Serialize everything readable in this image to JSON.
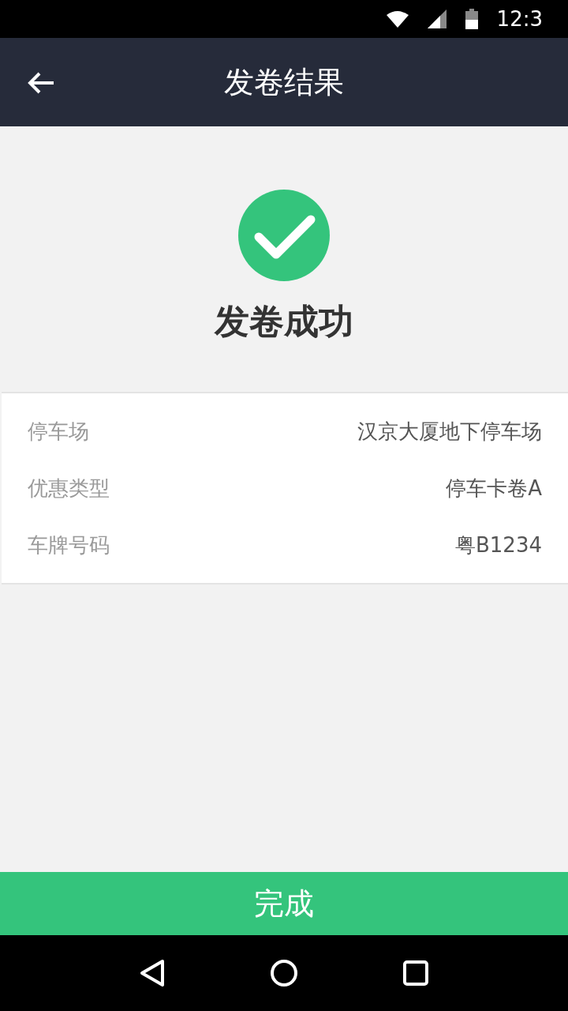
{
  "status_bar": {
    "time": "12:3"
  },
  "header": {
    "title": "发卷结果"
  },
  "result": {
    "title": "发卷成功"
  },
  "details": [
    {
      "label": "停车场",
      "value": "汉京大厦地下停车场"
    },
    {
      "label": "优惠类型",
      "value": "停车卡卷A"
    },
    {
      "label": "车牌号码",
      "value": "粤B1234"
    }
  ],
  "done_button": {
    "label": "完成"
  }
}
